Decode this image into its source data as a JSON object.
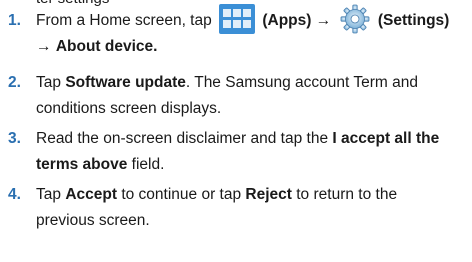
{
  "clipped_text": "ter settings",
  "steps": [
    {
      "number": "1.",
      "t1": "From a Home screen, tap",
      "apps_label": "(Apps)",
      "arrow1": "→",
      "settings_label": "(Settings)",
      "arrow2": "→",
      "about": "About device."
    },
    {
      "number": "2.",
      "t1": "Tap",
      "b1": "Software update",
      "t2": ". The Samsung account Term and",
      "t3": "conditions screen displays."
    },
    {
      "number": "3.",
      "t1": "Read the on-screen disclaimer and tap the",
      "b1": "I accept all the",
      "b2": "terms above",
      "t2": "field."
    },
    {
      "number": "4.",
      "t1": "Tap",
      "b1": "Accept",
      "t2": "to continue or tap",
      "b2": "Reject",
      "t3": "to return to the",
      "t4": "previous screen."
    }
  ],
  "icons": {
    "apps": "apps-grid-icon",
    "settings": "settings-gear-icon"
  },
  "colors": {
    "step_number": "#2a6fb0",
    "apps_icon_bg": "#3b8fd6",
    "text": "#1a1a1a"
  }
}
